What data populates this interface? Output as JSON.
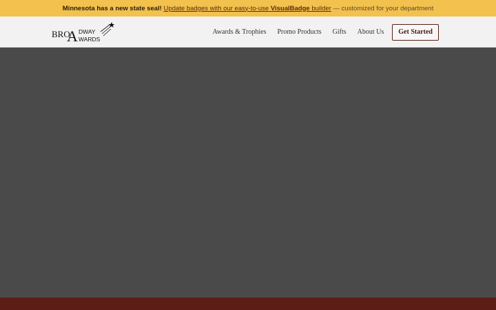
{
  "announcement": {
    "lead": "Minnesota has a new state seal!",
    "link_prefix": "Update badges with our easy-to-use",
    "link_strong": "VisualBadge",
    "link_suffix": "builder",
    "tail": "— customized for your department"
  },
  "brand": {
    "line1": "BRO",
    "big_a": "A",
    "line1b": "DWAY",
    "line2": "WARDS"
  },
  "nav": {
    "items": [
      {
        "label": "Awards & Trophies"
      },
      {
        "label": "Promo Products"
      },
      {
        "label": "Gifts"
      },
      {
        "label": "About Us"
      }
    ],
    "cta_label": "Get Started"
  },
  "colors": {
    "announcement_bg": "#f2c14e",
    "header_bg": "#f2f2f2",
    "hero_bg": "#4a4a4a",
    "footer_bg": "#5b1d16",
    "cta_border": "#5a1e16"
  }
}
